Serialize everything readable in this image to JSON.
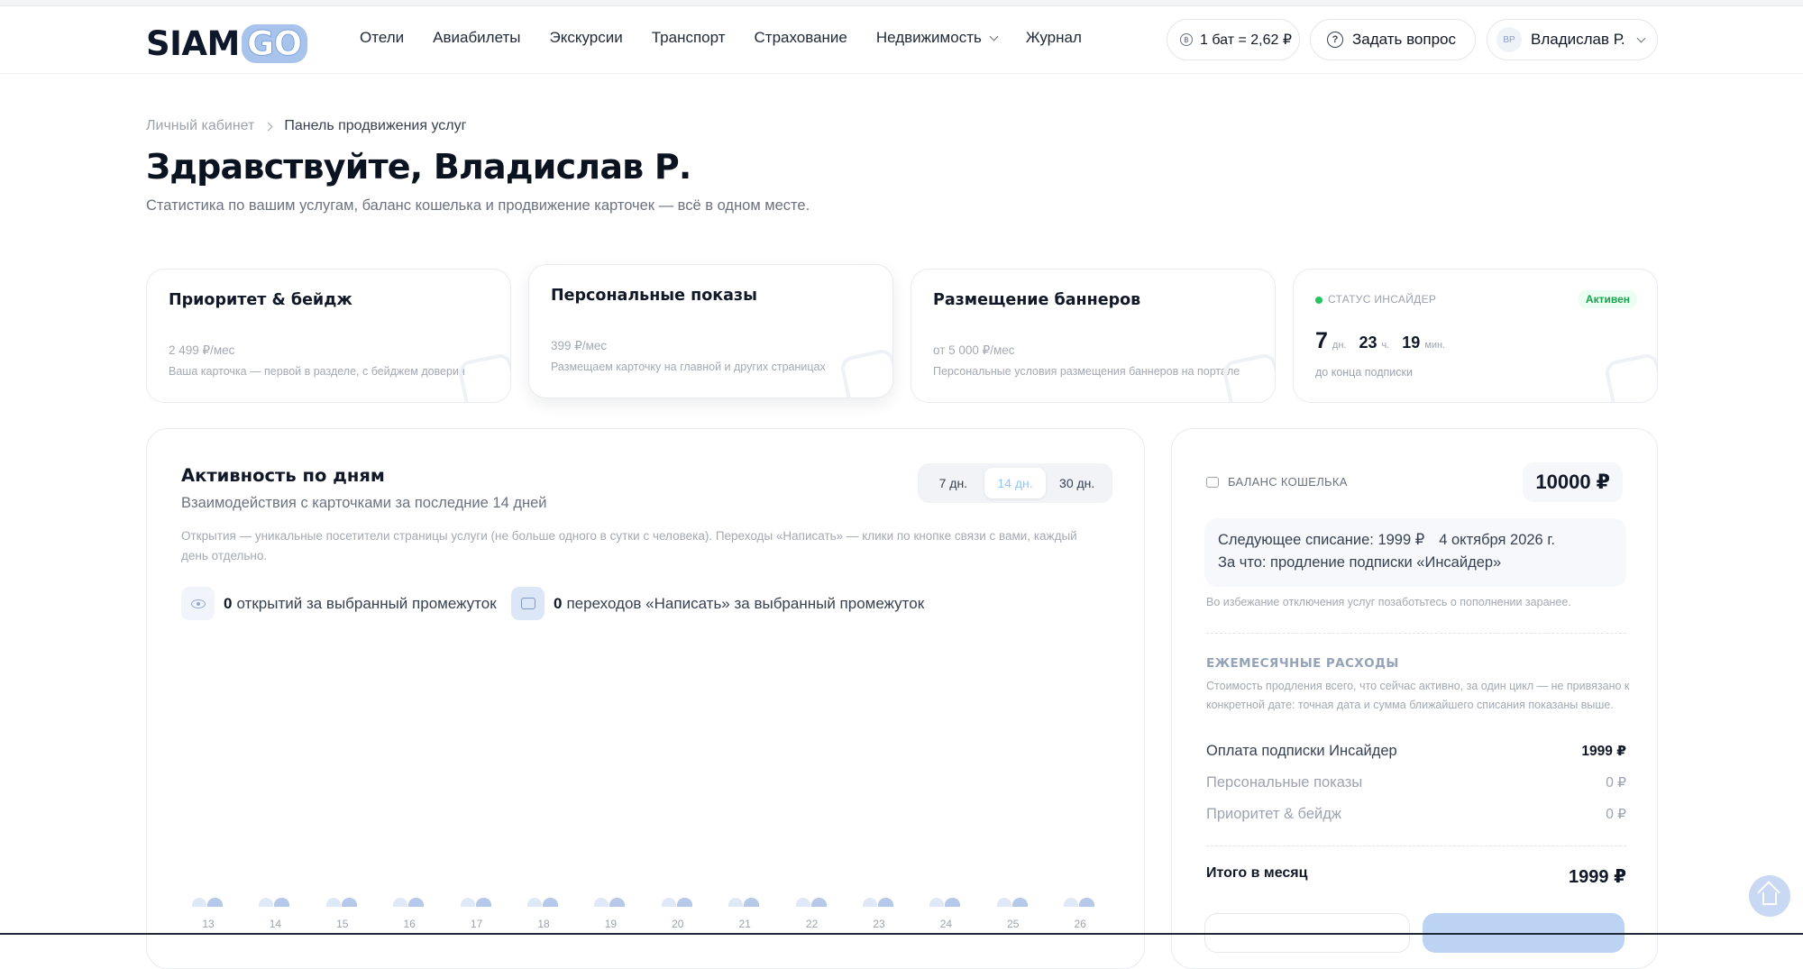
{
  "brand": {
    "logo_main": "SIAM",
    "logo_go": "GO"
  },
  "nav": {
    "items": [
      "Отели",
      "Авиабилеты",
      "Экскурсии",
      "Транспорт",
      "Страхование",
      "Недвижимость",
      "Журнал"
    ],
    "rate": "1 бат = 2,62 ₽",
    "ask": "Задать вопрос",
    "user_initials": "ВР",
    "user_name": "Владислав Р."
  },
  "breadcrumb": {
    "root": "Личный кабинет",
    "current": "Панель продвижения услуг"
  },
  "page": {
    "title": "Здравствуйте, Владислав Р.",
    "subtitle": "Статистика по вашим услугам, баланс кошелька и продвижение карточек — всё в одном месте."
  },
  "cards": [
    {
      "title": "Приоритет & бейдж",
      "price": "2 499 ₽/мес",
      "desc": "Ваша карточка — первой в разделе, с бейджем доверия"
    },
    {
      "title": "Персональные показы",
      "price": "399 ₽/мес",
      "desc": "Размещаем карточку на главной и других страницах"
    },
    {
      "title": "Размещение баннеров",
      "price": "от 5 000 ₽/мес",
      "desc": "Персональные условия размещения баннеров на портале"
    }
  ],
  "status": {
    "label": "СТАТУС ИНСАЙДЕР",
    "badge": "Активен",
    "days": "7",
    "days_unit": "дн.",
    "hours": "23",
    "hours_unit": "ч.",
    "minutes": "19",
    "minutes_unit": "мин.",
    "until": "до конца подписки"
  },
  "activity": {
    "title": "Активность по дням",
    "subtitle": "Взаимодействия с карточками за последние 14 дней",
    "note": "Открытия — уникальные посетители страницы услуги (не больше одного в сутки с человека). Переходы «Написать» — клики по кнопке связи с вами, каждый день отдельно.",
    "ranges": [
      "7 дн.",
      "14 дн.",
      "30 дн."
    ],
    "selected_range": "14 дн.",
    "opens_count": "0",
    "opens_label": "открытий за выбранный промежуток",
    "writes_count": "0",
    "writes_label": "переходов «Написать» за выбранный промежуток",
    "days": [
      "13",
      "14",
      "15",
      "16",
      "17",
      "18",
      "19",
      "20",
      "21",
      "22",
      "23",
      "24",
      "25",
      "26"
    ]
  },
  "wallet": {
    "label": "БАЛАНС КОШЕЛЬКА",
    "balance": "10000 ₽",
    "next_charge": "Следующее списание: 1999 ₽",
    "next_date": "4 октября 2026 г.",
    "purpose": "За что: продление подписки «Инсайдер»",
    "warning": "Во избежание отключения услуг позаботьтесь о пополнении заранее.",
    "monthly_title": "ЕЖЕМЕСЯЧНЫЕ РАСХОДЫ",
    "monthly_note": "Стоимость продления всего, что сейчас активно, за один цикл — не привязано к конкретной дате: точная дата и сумма ближайшего списания показаны выше.",
    "lines": [
      {
        "label": "Оплата подписки Инсайдер",
        "value": "1999 ₽"
      },
      {
        "label": "Персональные показы",
        "value": "0 ₽"
      },
      {
        "label": "Приоритет & бейдж",
        "value": "0 ₽"
      }
    ],
    "total_label": "Итого в месяц",
    "total_value": "1999 ₽"
  },
  "chart_data": {
    "type": "bar",
    "categories": [
      "13",
      "14",
      "15",
      "16",
      "17",
      "18",
      "19",
      "20",
      "21",
      "22",
      "23",
      "24",
      "25",
      "26"
    ],
    "series": [
      {
        "values": [
          0,
          0,
          0,
          0,
          0,
          0,
          0,
          0,
          0,
          0,
          0,
          0,
          0,
          0
        ],
        "color": "#dfe8f6"
      },
      {
        "values": [
          0,
          0,
          0,
          0,
          0,
          0,
          0,
          0,
          0,
          0,
          0,
          0,
          0,
          0
        ],
        "color": "#b6c9ea"
      }
    ],
    "title": "",
    "xlabel": "",
    "ylabel": ""
  },
  "colors": {
    "accent": "#b6c9ea",
    "status_green": "#22c55e"
  }
}
